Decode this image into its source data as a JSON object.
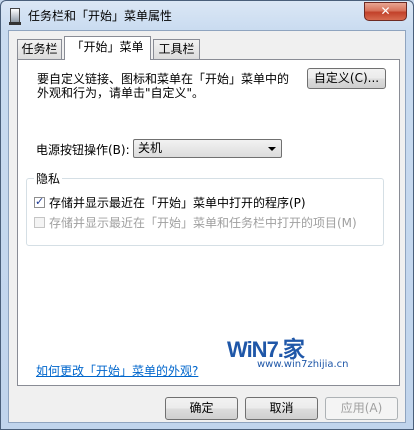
{
  "window": {
    "title": "任务栏和「开始」菜单属性",
    "close_symbol": "✕"
  },
  "tabs": [
    {
      "label": "任务栏",
      "active": false
    },
    {
      "label": "「开始」菜单",
      "active": true
    },
    {
      "label": "工具栏",
      "active": false
    }
  ],
  "start_menu": {
    "description_line1": "要自定义链接、图标和菜单在「开始」菜单中的",
    "description_line2": "外观和行为，请单击\"自定义\"。",
    "customize_button": "自定义(C)...",
    "power_label": "电源按钮操作(B):",
    "power_value": "关机",
    "privacy": {
      "title": "隐私",
      "option1_label": "存储并显示最近在「开始」菜单中打开的程序(P)",
      "option1_checked": true,
      "option2_label": "存储并显示最近在「开始」菜单和任务栏中打开的项目(M)",
      "option2_checked": false
    },
    "help_link": "如何更改「开始」菜单的外观?"
  },
  "footer": {
    "ok_button": "确定",
    "cancel_button": "取消",
    "apply_button": "应用(A)"
  },
  "watermark": {
    "logo_text": "WiN7.家",
    "url_text": "www.win7zhijia.cn"
  },
  "icons": {
    "title_icon": "taskbar-properties-icon",
    "close_icon": "close-icon",
    "dropdown_icon": "chevron-down-icon",
    "check_icon": "checkmark-icon"
  }
}
